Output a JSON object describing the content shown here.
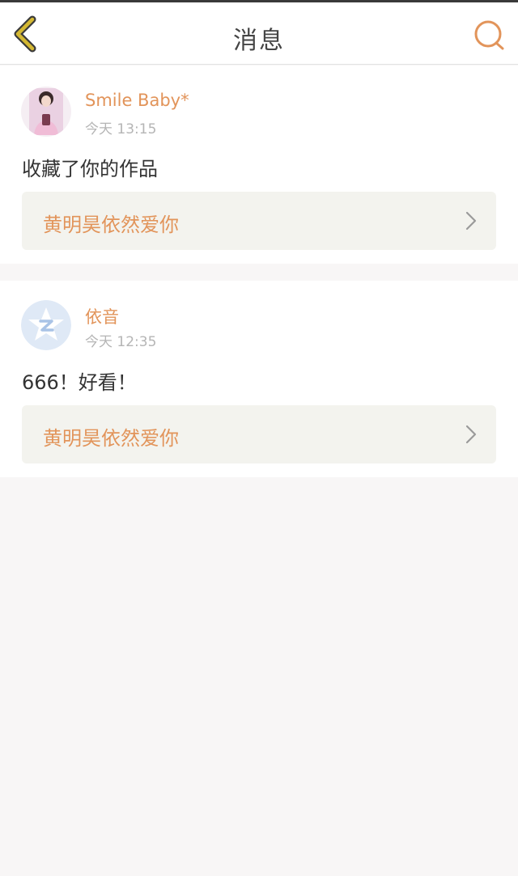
{
  "header": {
    "title": "消息",
    "back_icon": "back-arrow-icon",
    "search_icon": "search-icon"
  },
  "colors": {
    "accent": "#e2945a",
    "back_icon": "#d4b832",
    "card_link_bg": "#f3f3ee",
    "page_bg": "#f8f6f6"
  },
  "messages": [
    {
      "username": "Smile Baby*",
      "time": "今天 13:15",
      "content": "收藏了你的作品",
      "work_title": "黄明昊依然爱你",
      "avatar": "photo-avatar"
    },
    {
      "username": "依音",
      "time": "今天 12:35",
      "content": "666！好看！",
      "work_title": "黄明昊依然爱你",
      "avatar": "qzone-star-avatar"
    }
  ]
}
